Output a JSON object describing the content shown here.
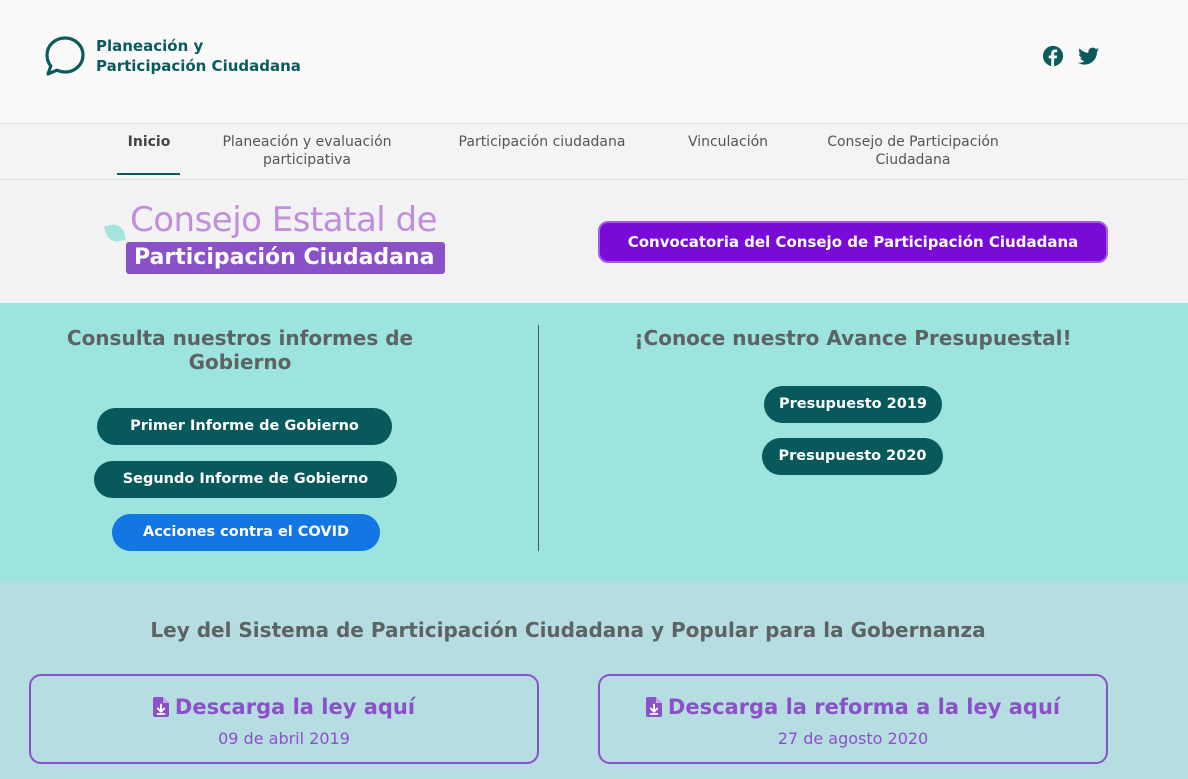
{
  "header": {
    "logo_line1": "Planeación y",
    "logo_line2": "Participación Ciudadana",
    "social": [
      "facebook-icon",
      "twitter-icon"
    ],
    "brand_color": "#0b5a5d"
  },
  "nav": {
    "items": [
      {
        "line1": "Inicio",
        "line2": ""
      },
      {
        "line1": "Planeación y evaluación",
        "line2": "participativa"
      },
      {
        "line1": "Participación ciudadana",
        "line2": ""
      },
      {
        "line1": "Vinculación",
        "line2": ""
      },
      {
        "line1": "Consejo de Participación",
        "line2": "Ciudadana"
      }
    ],
    "active_index": 0
  },
  "banner": {
    "logo_line1": "Consejo Estatal de",
    "logo_line2": "Participación Ciudadana",
    "convocatoria_label": "Convocatoria del Consejo de Participación Ciudadana",
    "button_color": "#7a0ad6"
  },
  "informes": {
    "title_line1": "Consulta nuestros informes de",
    "title_line2": "Gobierno",
    "buttons": [
      "Primer Informe de Gobierno",
      "Segundo Informe de Gobierno",
      "Acciones contra el COVID"
    ]
  },
  "presupuesto": {
    "title": "¡Conoce nuestro Avance Presupuestal!",
    "buttons": [
      "Presupuesto 2019",
      "Presupuesto 2020"
    ]
  },
  "ley": {
    "title": "Ley del Sistema de Participación Ciudadana y Popular para la Gobernanza",
    "downloads": [
      {
        "label": "Descarga la ley aquí",
        "date": "09 de abril 2019",
        "icon": "file-download-icon"
      },
      {
        "label": "Descarga la reforma a la ley aquí",
        "date": "27 de agosto 2020",
        "icon": "file-download-icon"
      }
    ],
    "accent_color": "#8b51c9"
  }
}
